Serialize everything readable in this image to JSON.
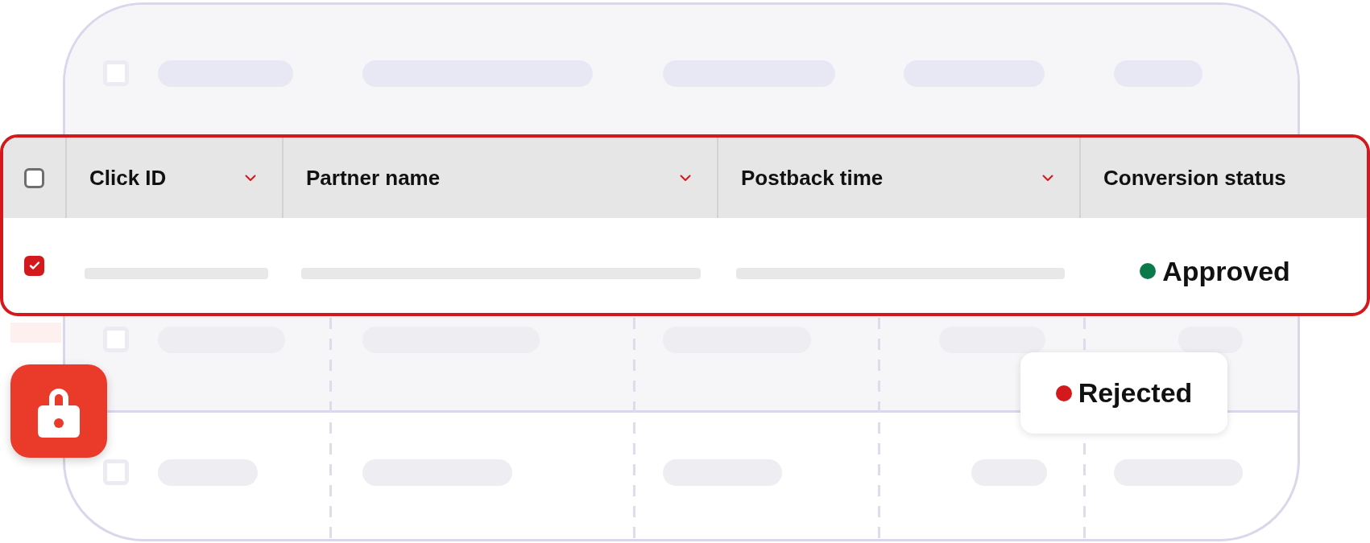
{
  "table": {
    "select_all": {
      "checked": false
    },
    "columns": [
      {
        "label": "Click ID",
        "sortable": true
      },
      {
        "label": "Partner name",
        "sortable": true
      },
      {
        "label": "Postback time",
        "sortable": true
      },
      {
        "label": "Conversion status",
        "sortable": false
      }
    ],
    "row": {
      "checked": true,
      "status": {
        "label": "Approved",
        "color": "#0b7a4b"
      }
    }
  },
  "status_popup": {
    "label": "Rejected",
    "color": "#d3191c"
  }
}
